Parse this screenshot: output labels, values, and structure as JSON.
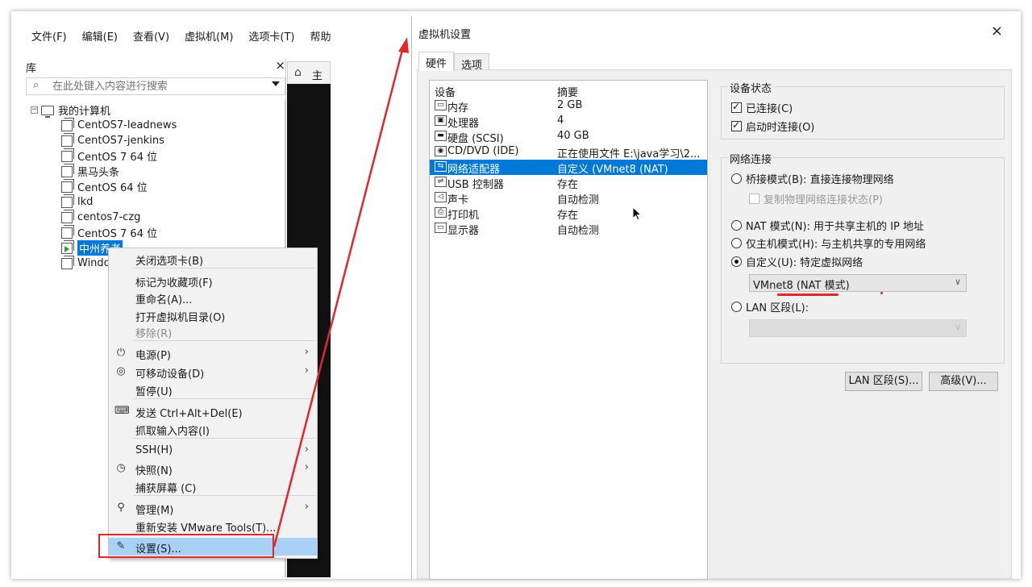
{
  "menubar": [
    "文件(F)",
    "编辑(E)",
    "查看(V)",
    "虚拟机(M)",
    "选项卡(T)",
    "帮助(H)"
  ],
  "library": {
    "title": "库",
    "close": "×",
    "search_placeholder": "在此处键入内容进行搜索",
    "root": "我的计算机",
    "vms": [
      "CentOS7-leadnews",
      "CentOS7-jenkins",
      "CentOS 7 64 位",
      "黑马头条",
      "CentOS 64 位",
      "lkd",
      "centos7-czg",
      "CentOS 7 64 位",
      "中州养老",
      "Windo"
    ]
  },
  "home_tab": "主",
  "context_menu": [
    {
      "label": "关闭选项卡(B)",
      "icon": "",
      "arrow": false,
      "disabled": false
    },
    {
      "label": "标记为收藏项(F)",
      "icon": "",
      "arrow": false,
      "disabled": false
    },
    {
      "label": "重命名(A)...",
      "icon": "",
      "arrow": false,
      "disabled": false
    },
    {
      "label": "打开虚拟机目录(O)",
      "icon": "",
      "arrow": false,
      "disabled": false
    },
    {
      "label": "移除(R)",
      "icon": "",
      "arrow": false,
      "disabled": true
    },
    {
      "label": "电源(P)",
      "icon": "power-icon",
      "arrow": true,
      "disabled": false
    },
    {
      "label": "可移动设备(D)",
      "icon": "removable-device-icon",
      "arrow": true,
      "disabled": false
    },
    {
      "label": "暂停(U)",
      "icon": "",
      "arrow": false,
      "disabled": false
    },
    {
      "label": "发送 Ctrl+Alt+Del(E)",
      "icon": "keyboard-icon",
      "arrow": false,
      "disabled": false
    },
    {
      "label": "抓取输入内容(I)",
      "icon": "",
      "arrow": false,
      "disabled": false
    },
    {
      "label": "SSH(H)",
      "icon": "",
      "arrow": true,
      "disabled": false
    },
    {
      "label": "快照(N)",
      "icon": "snapshot-icon",
      "arrow": true,
      "disabled": false
    },
    {
      "label": "捕获屏幕 (C)",
      "icon": "",
      "arrow": false,
      "disabled": false
    },
    {
      "label": "管理(M)",
      "icon": "wrench-icon",
      "arrow": true,
      "disabled": false
    },
    {
      "label": "重新安装 VMware Tools(T)...",
      "icon": "",
      "arrow": false,
      "disabled": false
    },
    {
      "label": "设置(S)...",
      "icon": "settings-icon",
      "arrow": false,
      "disabled": false
    }
  ],
  "dialog": {
    "title": "虚拟机设置",
    "close": "×",
    "tabs": [
      "硬件",
      "选项"
    ],
    "device_header": "设备",
    "summary_header": "摘要",
    "devices": [
      {
        "name": "内存",
        "summary": "2 GB",
        "icon": "memory-icon"
      },
      {
        "name": "处理器",
        "summary": "4",
        "icon": "cpu-icon"
      },
      {
        "name": "硬盘 (SCSI)",
        "summary": "40 GB",
        "icon": "disk-icon"
      },
      {
        "name": "CD/DVD (IDE)",
        "summary": "正在使用文件 E:\\java学习\\2...",
        "icon": "cd-icon"
      },
      {
        "name": "网络适配器",
        "summary": "自定义 (VMnet8 (NAT)",
        "icon": "network-icon"
      },
      {
        "name": "USB 控制器",
        "summary": "存在",
        "icon": "usb-icon"
      },
      {
        "name": "声卡",
        "summary": "自动检测",
        "icon": "speaker-icon"
      },
      {
        "name": "打印机",
        "summary": "存在",
        "icon": "printer-icon"
      },
      {
        "name": "显示器",
        "summary": "自动检测",
        "icon": "monitor-icon"
      }
    ],
    "device_status": {
      "title": "设备状态",
      "connected": "已连接(C)",
      "connect_on_power": "启动时连接(O)"
    },
    "network": {
      "title": "网络连接",
      "bridged": "桥接模式(B): 直接连接物理网络",
      "replicate": "复制物理网络连接状态(P)",
      "nat": "NAT 模式(N): 用于共享主机的 IP 地址",
      "host_only": "仅主机模式(H): 与主机共享的专用网络",
      "custom": "自定义(U): 特定虚拟网络",
      "custom_value": "VMnet8 (NAT 模式)",
      "lan": "LAN 区段(L):",
      "lan_value": ""
    },
    "buttons": {
      "lan_segments": "LAN 区段(S)...",
      "advanced": "高级(V)..."
    }
  },
  "colors": {
    "selection": "#0078d7",
    "highlight": "#a8d1f5",
    "annotation_red": "#e0282b"
  }
}
